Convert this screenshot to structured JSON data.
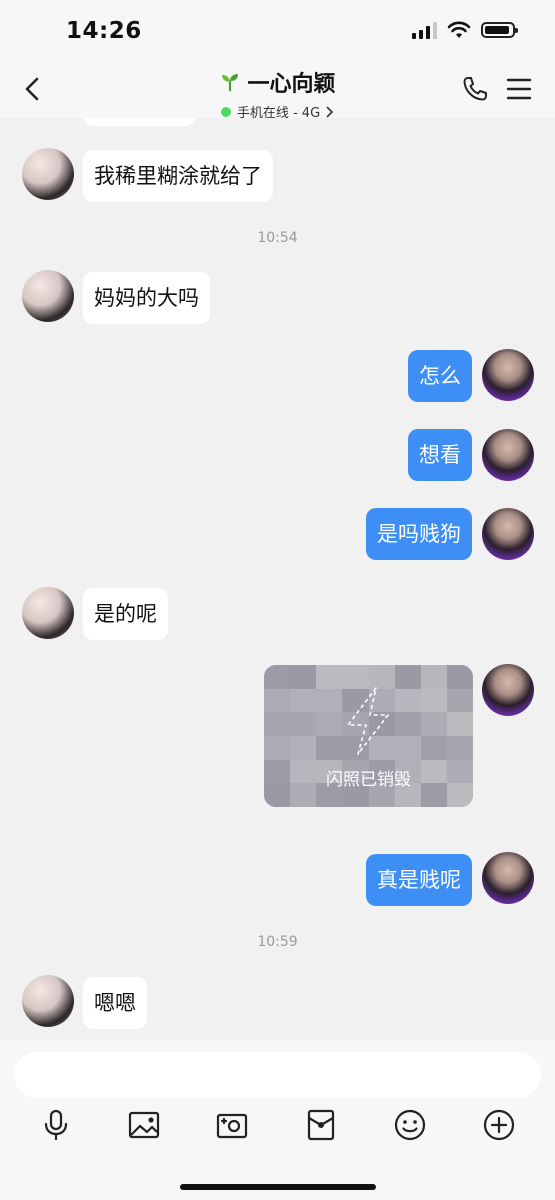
{
  "status_bar": {
    "time": "14:26"
  },
  "header": {
    "contact_name": "一心向颖",
    "status_text": "手机在线 - 4G",
    "status_color": "#4cd964"
  },
  "messages": [
    {
      "side": "in",
      "type": "text",
      "text": "我稀里糊涂就给了"
    },
    {
      "type": "timestamp",
      "text": "10:54"
    },
    {
      "side": "in",
      "type": "text",
      "text": "妈妈的大吗"
    },
    {
      "side": "out",
      "type": "text",
      "text": "怎么"
    },
    {
      "side": "out",
      "type": "text",
      "text": "想看"
    },
    {
      "side": "out",
      "type": "text",
      "text": "是吗贱狗"
    },
    {
      "side": "in",
      "type": "text",
      "text": "是的呢"
    },
    {
      "side": "out",
      "type": "flash",
      "text": "闪照已销毁"
    },
    {
      "side": "out",
      "type": "text",
      "text": "真是贱呢"
    },
    {
      "type": "timestamp",
      "text": "10:59"
    },
    {
      "side": "in",
      "type": "text",
      "text": "嗯嗯"
    }
  ],
  "input": {
    "placeholder": ""
  },
  "toolbar": [
    "microphone-icon",
    "image-icon",
    "camera-icon",
    "red-packet-icon",
    "emoji-icon",
    "plus-icon"
  ],
  "colors": {
    "outgoing_bubble": "#3d8ff5",
    "incoming_bubble": "#ffffff",
    "background": "#f1f1f1"
  }
}
